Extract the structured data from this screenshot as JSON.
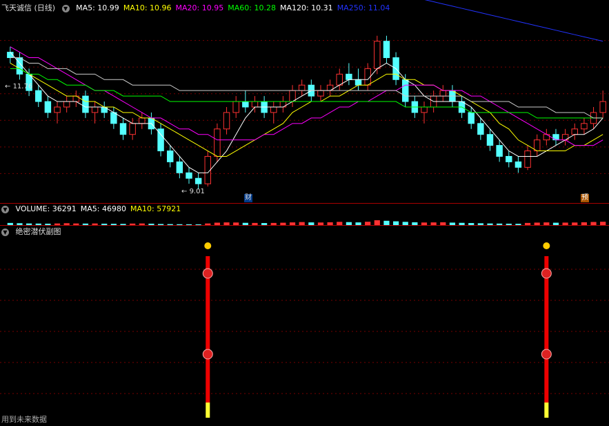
{
  "price_header": {
    "title": "飞天诚信 (日线)",
    "icon": "chevron-down-icon",
    "ma_labels": [
      {
        "text": "MA5: 10.99",
        "color": "#ffffff"
      },
      {
        "text": "MA10: 10.96",
        "color": "#ffff00"
      },
      {
        "text": "MA20: 10.95",
        "color": "#ff00ff"
      },
      {
        "text": "MA60: 10.28",
        "color": "#00ff00"
      },
      {
        "text": "MA120: 10.31",
        "color": "#ffffff"
      },
      {
        "text": "MA250: 11.04",
        "color": "#2233ff"
      }
    ]
  },
  "price_annotations": {
    "high": "11.76",
    "low": "9.01",
    "finance_badge": "财",
    "forecast_badge": "预"
  },
  "volume_header": {
    "icon": "chevron-down-icon",
    "labels": [
      {
        "text": "VOLUME: 36291",
        "color": "#ffffff"
      },
      {
        "text": "MA5: 46980",
        "color": "#ffffff"
      },
      {
        "text": "MA10: 57921",
        "color": "#ffff00"
      }
    ]
  },
  "indicator_header": {
    "title": "绝密潜伏副图",
    "icon": "chevron-down-icon"
  },
  "footer_note": "用到未来数据",
  "colors": {
    "up": "#ff3232",
    "down": "#54ffff",
    "grid": "#7a0000",
    "separator": "#aa0000",
    "signal": "#ee0000",
    "dot": "#ffcc00"
  },
  "chart_data": {
    "type": "candlestick",
    "price_range": [
      8.8,
      12.2
    ],
    "candles": [
      [
        11.5,
        11.6,
        11.3,
        11.4
      ],
      [
        11.4,
        11.5,
        11.0,
        11.1
      ],
      [
        11.1,
        11.2,
        10.7,
        10.8
      ],
      [
        10.8,
        10.9,
        10.5,
        10.6
      ],
      [
        10.6,
        10.7,
        10.3,
        10.4
      ],
      [
        10.4,
        10.6,
        10.2,
        10.5
      ],
      [
        10.5,
        10.7,
        10.4,
        10.6
      ],
      [
        10.6,
        10.8,
        10.5,
        10.7
      ],
      [
        10.7,
        10.8,
        10.3,
        10.4
      ],
      [
        10.4,
        10.6,
        10.2,
        10.5
      ],
      [
        10.5,
        10.6,
        10.3,
        10.4
      ],
      [
        10.4,
        10.5,
        10.1,
        10.2
      ],
      [
        10.2,
        10.3,
        9.9,
        10.0
      ],
      [
        10.0,
        10.3,
        9.9,
        10.2
      ],
      [
        10.2,
        10.4,
        10.1,
        10.3
      ],
      [
        10.3,
        10.4,
        10.0,
        10.1
      ],
      [
        10.1,
        10.2,
        9.6,
        9.7
      ],
      [
        9.7,
        9.8,
        9.4,
        9.5
      ],
      [
        9.5,
        9.6,
        9.2,
        9.3
      ],
      [
        9.3,
        9.4,
        9.1,
        9.2
      ],
      [
        9.2,
        9.3,
        9.0,
        9.1
      ],
      [
        9.1,
        9.7,
        9.05,
        9.6
      ],
      [
        9.6,
        10.2,
        9.5,
        10.1
      ],
      [
        10.1,
        10.5,
        10.0,
        10.4
      ],
      [
        10.4,
        10.7,
        10.3,
        10.6
      ],
      [
        10.6,
        10.8,
        10.4,
        10.5
      ],
      [
        10.5,
        10.7,
        10.4,
        10.6
      ],
      [
        10.6,
        10.7,
        10.3,
        10.4
      ],
      [
        10.4,
        10.6,
        10.2,
        10.5
      ],
      [
        10.5,
        10.7,
        10.4,
        10.6
      ],
      [
        10.6,
        10.9,
        10.5,
        10.8
      ],
      [
        10.8,
        11.0,
        10.7,
        10.9
      ],
      [
        10.9,
        11.0,
        10.6,
        10.7
      ],
      [
        10.7,
        10.9,
        10.6,
        10.8
      ],
      [
        10.8,
        11.0,
        10.7,
        10.9
      ],
      [
        10.9,
        11.2,
        10.8,
        11.1
      ],
      [
        11.1,
        11.3,
        10.9,
        11.0
      ],
      [
        11.0,
        11.2,
        10.8,
        10.9
      ],
      [
        10.9,
        11.3,
        10.8,
        11.2
      ],
      [
        11.2,
        11.8,
        11.1,
        11.7
      ],
      [
        11.7,
        11.8,
        11.3,
        11.4
      ],
      [
        11.4,
        11.5,
        10.9,
        11.0
      ],
      [
        11.0,
        11.1,
        10.5,
        10.6
      ],
      [
        10.6,
        10.7,
        10.3,
        10.4
      ],
      [
        10.4,
        10.6,
        10.2,
        10.5
      ],
      [
        10.5,
        10.8,
        10.4,
        10.7
      ],
      [
        10.7,
        10.9,
        10.6,
        10.8
      ],
      [
        10.8,
        10.9,
        10.5,
        10.6
      ],
      [
        10.6,
        10.7,
        10.3,
        10.4
      ],
      [
        10.4,
        10.5,
        10.1,
        10.2
      ],
      [
        10.2,
        10.3,
        9.9,
        10.0
      ],
      [
        10.0,
        10.1,
        9.7,
        9.8
      ],
      [
        9.8,
        9.9,
        9.5,
        9.6
      ],
      [
        9.6,
        9.7,
        9.4,
        9.5
      ],
      [
        9.5,
        9.6,
        9.3,
        9.4
      ],
      [
        9.4,
        9.8,
        9.35,
        9.7
      ],
      [
        9.7,
        10.0,
        9.6,
        9.9
      ],
      [
        9.9,
        10.1,
        9.8,
        10.0
      ],
      [
        10.0,
        10.1,
        9.8,
        9.9
      ],
      [
        9.9,
        10.1,
        9.8,
        10.0
      ],
      [
        10.0,
        10.2,
        9.9,
        10.1
      ],
      [
        10.1,
        10.3,
        10.0,
        10.2
      ],
      [
        10.2,
        10.5,
        10.1,
        10.4
      ],
      [
        10.4,
        10.8,
        10.3,
        10.6
      ]
    ],
    "ma_lines": [
      {
        "name": "MA5",
        "color": "#ffffff",
        "values": [
          11.5,
          11.3,
          11.1,
          10.9,
          10.7,
          10.6,
          10.6,
          10.6,
          10.5,
          10.5,
          10.5,
          10.4,
          10.3,
          10.2,
          10.2,
          10.2,
          10.0,
          9.8,
          9.6,
          9.4,
          9.3,
          9.3,
          9.5,
          9.7,
          10.0,
          10.3,
          10.5,
          10.5,
          10.5,
          10.5,
          10.6,
          10.7,
          10.8,
          10.8,
          10.8,
          10.9,
          11.0,
          11.0,
          11.0,
          11.2,
          11.3,
          11.2,
          11.0,
          10.9,
          10.7,
          10.6,
          10.6,
          10.6,
          10.6,
          10.5,
          10.3,
          10.1,
          9.9,
          9.7,
          9.6,
          9.6,
          9.6,
          9.7,
          9.8,
          9.9,
          10.0,
          10.0,
          10.1,
          10.3
        ]
      },
      {
        "name": "MA10",
        "color": "#ffff00",
        "values": [
          11.3,
          11.2,
          11.1,
          11.0,
          10.9,
          10.8,
          10.7,
          10.7,
          10.6,
          10.6,
          10.5,
          10.5,
          10.4,
          10.4,
          10.3,
          10.3,
          10.2,
          10.1,
          10.0,
          9.9,
          9.8,
          9.7,
          9.6,
          9.6,
          9.7,
          9.8,
          9.9,
          10.0,
          10.1,
          10.2,
          10.4,
          10.5,
          10.6,
          10.6,
          10.7,
          10.7,
          10.8,
          10.9,
          10.9,
          11.0,
          11.1,
          11.1,
          11.0,
          11.0,
          10.9,
          10.9,
          10.8,
          10.8,
          10.7,
          10.6,
          10.5,
          10.4,
          10.2,
          10.1,
          9.9,
          9.8,
          9.7,
          9.7,
          9.7,
          9.7,
          9.8,
          9.8,
          9.9,
          10.0
        ]
      },
      {
        "name": "MA20",
        "color": "#ff00ff",
        "values": [
          11.6,
          11.5,
          11.4,
          11.4,
          11.3,
          11.2,
          11.1,
          11.0,
          10.9,
          10.8,
          10.8,
          10.7,
          10.6,
          10.5,
          10.4,
          10.3,
          10.3,
          10.2,
          10.1,
          10.1,
          10.0,
          10.0,
          9.9,
          9.9,
          9.9,
          9.9,
          9.9,
          10.0,
          10.0,
          10.1,
          10.2,
          10.2,
          10.3,
          10.3,
          10.4,
          10.5,
          10.5,
          10.6,
          10.6,
          10.7,
          10.8,
          10.8,
          10.9,
          10.9,
          10.9,
          10.9,
          10.8,
          10.8,
          10.8,
          10.7,
          10.7,
          10.6,
          10.5,
          10.4,
          10.3,
          10.2,
          10.1,
          10.0,
          9.9,
          9.9,
          9.8,
          9.8,
          9.8,
          9.9
        ]
      },
      {
        "name": "MA60",
        "color": "#00ff00",
        "values": [
          11.2,
          11.2,
          11.1,
          11.1,
          11.0,
          11.0,
          10.9,
          10.9,
          10.9,
          10.8,
          10.8,
          10.8,
          10.7,
          10.7,
          10.7,
          10.7,
          10.7,
          10.6,
          10.6,
          10.6,
          10.6,
          10.6,
          10.6,
          10.6,
          10.6,
          10.6,
          10.6,
          10.6,
          10.6,
          10.6,
          10.6,
          10.6,
          10.6,
          10.6,
          10.6,
          10.6,
          10.6,
          10.6,
          10.6,
          10.6,
          10.6,
          10.6,
          10.5,
          10.5,
          10.5,
          10.5,
          10.5,
          10.5,
          10.5,
          10.4,
          10.4,
          10.4,
          10.4,
          10.4,
          10.4,
          10.4,
          10.3,
          10.3,
          10.3,
          10.3,
          10.3,
          10.3,
          10.3,
          10.3
        ]
      },
      {
        "name": "MA120",
        "color": "#cccccc",
        "values": [
          11.4,
          11.4,
          11.3,
          11.3,
          11.2,
          11.2,
          11.2,
          11.1,
          11.1,
          11.1,
          11.0,
          11.0,
          11.0,
          10.9,
          10.9,
          10.9,
          10.9,
          10.9,
          10.8,
          10.8,
          10.8,
          10.8,
          10.8,
          10.8,
          10.8,
          10.8,
          10.8,
          10.8,
          10.8,
          10.8,
          10.8,
          10.8,
          10.8,
          10.8,
          10.8,
          10.8,
          10.8,
          10.8,
          10.8,
          10.8,
          10.8,
          10.8,
          10.7,
          10.7,
          10.7,
          10.7,
          10.7,
          10.7,
          10.7,
          10.6,
          10.6,
          10.6,
          10.6,
          10.6,
          10.5,
          10.5,
          10.5,
          10.5,
          10.4,
          10.4,
          10.4,
          10.4,
          10.3,
          10.3
        ]
      },
      {
        "name": "MA250",
        "color": "#2233ff",
        "values": [
          14.3,
          14.25,
          14.2,
          14.15,
          14.1,
          14.05,
          14.0,
          13.95,
          13.9,
          13.86,
          13.82,
          13.78,
          13.74,
          13.7,
          13.66,
          13.62,
          13.58,
          13.54,
          13.5,
          13.46,
          13.42,
          13.38,
          13.34,
          13.3,
          13.26,
          13.22,
          13.18,
          13.14,
          13.1,
          13.06,
          13.02,
          12.98,
          12.94,
          12.9,
          12.86,
          12.82,
          12.78,
          12.74,
          12.7,
          12.66,
          12.62,
          12.58,
          12.54,
          12.5,
          12.46,
          12.42,
          12.38,
          12.34,
          12.3,
          12.26,
          12.22,
          12.18,
          12.14,
          12.1,
          12.06,
          12.02,
          11.98,
          11.94,
          11.9,
          11.86,
          11.82,
          11.78,
          11.74,
          11.7
        ]
      }
    ],
    "volume": [
      40,
      35,
      30,
      28,
      26,
      30,
      35,
      30,
      28,
      30,
      26,
      24,
      22,
      28,
      30,
      26,
      20,
      18,
      16,
      15,
      14,
      30,
      45,
      50,
      48,
      42,
      40,
      38,
      40,
      44,
      50,
      56,
      50,
      48,
      52,
      60,
      55,
      50,
      62,
      90,
      80,
      70,
      60,
      52,
      48,
      50,
      52,
      46,
      42,
      38,
      34,
      30,
      28,
      26,
      24,
      40,
      46,
      50,
      44,
      46,
      48,
      52,
      58,
      62
    ],
    "signals": [
      21,
      57
    ]
  }
}
